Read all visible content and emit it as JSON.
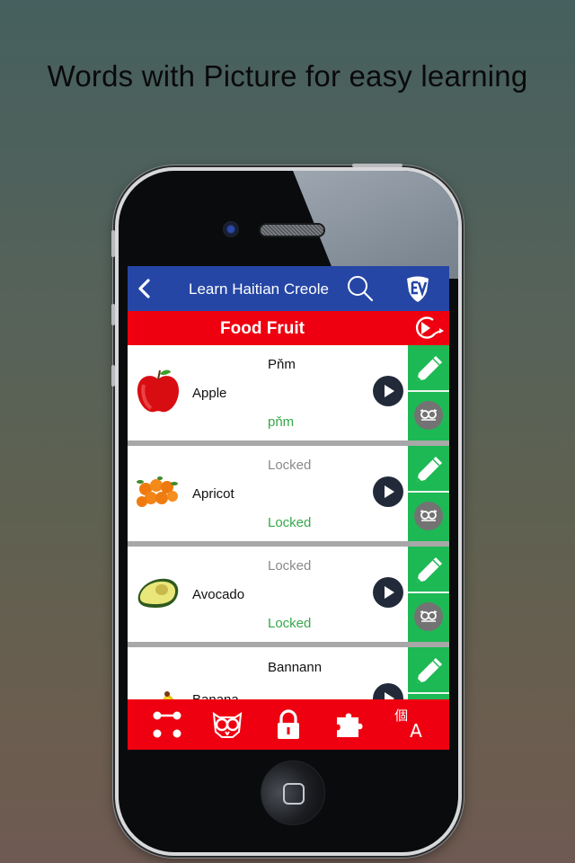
{
  "headline": "Words with Picture for easy learning",
  "app": {
    "nav_title": "Learn Haitian Creole",
    "icons": {
      "back": "chevron-left-icon",
      "search": "search-icon",
      "logo": "ev-shield-logo",
      "autoplay": "autoplay-icon"
    },
    "category_title": "Food Fruit",
    "colors": {
      "navbar": "#2546a5",
      "accent_red": "#ee0010",
      "action_green": "#1db954",
      "phonetic_green": "#36a84b",
      "play_dark": "#222a3a"
    }
  },
  "words": [
    {
      "english": "Apple",
      "translation": "Pňm",
      "phonetic": "pňm",
      "locked": false,
      "image": "apple"
    },
    {
      "english": "Apricot",
      "translation": "Locked",
      "phonetic": "Locked",
      "locked": true,
      "image": "apricot"
    },
    {
      "english": "Avocado",
      "translation": "Locked",
      "phonetic": "Locked",
      "locked": true,
      "image": "avocado"
    },
    {
      "english": "Banana",
      "translation": "Bannann",
      "phonetic": "",
      "locked": false,
      "image": "banana"
    }
  ],
  "tabbar": {
    "items": [
      {
        "name": "flashcards",
        "icon": "connect-dots-icon"
      },
      {
        "name": "owl-quiz",
        "icon": "owl-icon"
      },
      {
        "name": "unlock",
        "icon": "lock-icon"
      },
      {
        "name": "puzzle",
        "icon": "puzzle-icon"
      },
      {
        "name": "translate",
        "icon": "translate-icon",
        "glyph_cjk": "個",
        "glyph_latin": "A"
      }
    ]
  }
}
